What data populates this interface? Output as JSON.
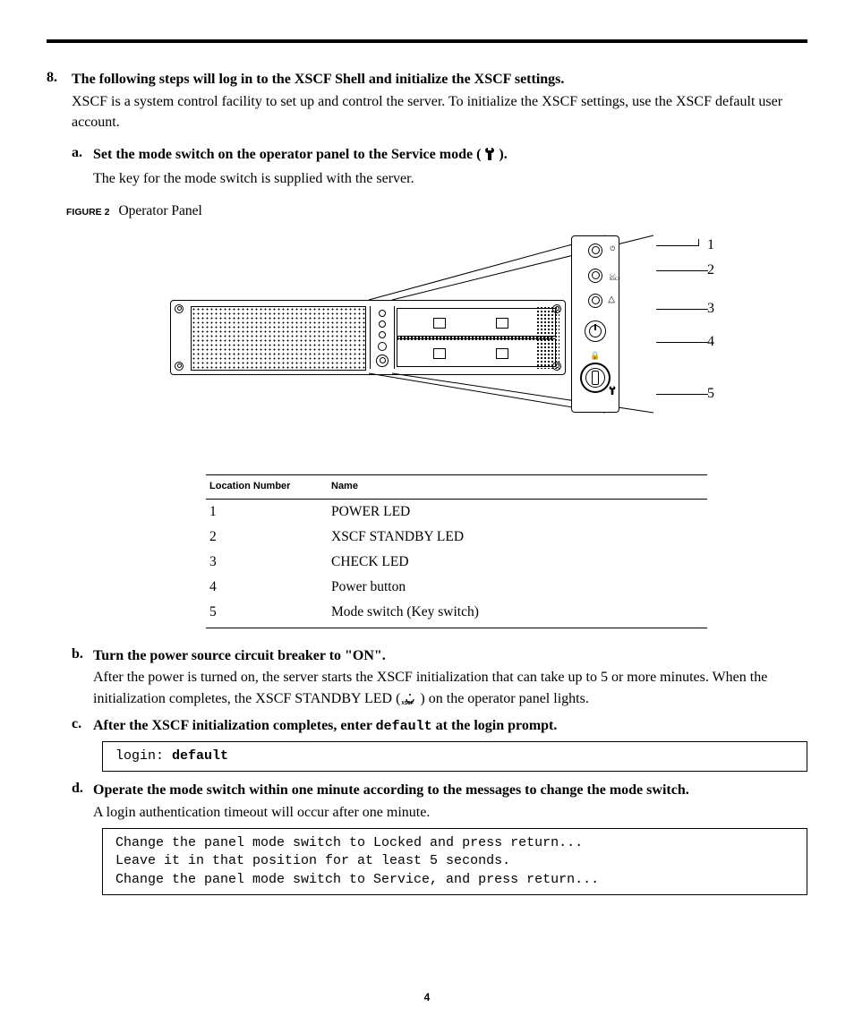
{
  "page_number": "4",
  "step8": {
    "number": "8.",
    "title": "The following steps will log in to the XSCF Shell and initialize the XSCF settings.",
    "body": "XSCF is a system control facility to set up and control the server. To initialize the XSCF settings, use the XSCF default user account.",
    "a": {
      "letter": "a.",
      "title_pre": "Set the mode switch on the operator panel to the Service mode (",
      "title_post": ").",
      "body": "The key for the mode switch is supplied with the server."
    },
    "b": {
      "letter": "b.",
      "title": "Turn the power source circuit breaker to \"ON\".",
      "body_pre": "After the power is turned on, the server starts the XSCF initialization that can take up to 5 or more minutes. When the initialization completes, the XSCF STANDBY LED (",
      "body_post": ") on the operator panel lights."
    },
    "c": {
      "letter": "c.",
      "title_pre": "After the XSCF initialization completes, enter ",
      "title_code": "default",
      "title_post": " at the login prompt.",
      "code_prefix": "login: ",
      "code_bold": "default"
    },
    "d": {
      "letter": "d.",
      "title": "Operate the mode switch within one minute according to the messages to change the mode switch.",
      "body": "A login authentication timeout will occur after one minute.",
      "code": "Change the panel mode switch to Locked and press return...\nLeave it in that position for at least 5 seconds.\nChange the panel mode switch to Service, and press return..."
    }
  },
  "figure": {
    "label": "FIGURE 2",
    "caption": "Operator Panel",
    "callouts": [
      "1",
      "2",
      "3",
      "4",
      "5"
    ],
    "xscf_label": "XSCF"
  },
  "legend": {
    "headers": {
      "loc": "Location Number",
      "name": "Name"
    },
    "rows": [
      {
        "loc": "1",
        "name": "POWER LED"
      },
      {
        "loc": "2",
        "name": "XSCF STANDBY LED"
      },
      {
        "loc": "3",
        "name": "CHECK LED"
      },
      {
        "loc": "4",
        "name": "Power button"
      },
      {
        "loc": "5",
        "name": "Mode switch (Key switch)"
      }
    ]
  },
  "icons": {
    "xscf_small": "XSCF"
  }
}
